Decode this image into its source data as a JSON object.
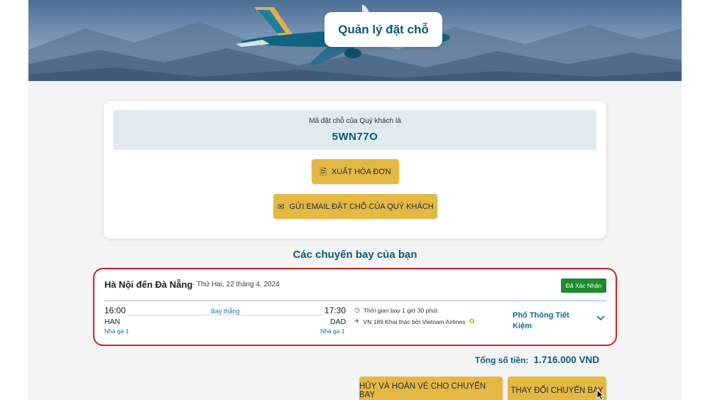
{
  "hero": {
    "title": "Quản lý đặt chỗ"
  },
  "booking": {
    "code_label": "Mã đặt chỗ của Quý khách là",
    "code": "5WN77O",
    "invoice_button": {
      "icon": "document-icon",
      "label": "XUẤT HÓA ĐƠN"
    },
    "email_button": {
      "icon": "mail-icon",
      "label": "GỬI EMAIL ĐẶT CHỖ CỦA QUÝ KHÁCH"
    }
  },
  "flights": {
    "heading": "Các chuyến bay của bạn",
    "items": [
      {
        "route": "Hà Nội đến Đà Nẵng",
        "date": "- Thứ Hai, 22 tháng 4, 2024",
        "status": "Đã Xác Nhận",
        "depart_time": "16:00",
        "depart_code": "HAN",
        "depart_terminal": "Nhà ga 1",
        "arrive_time": "17:30",
        "arrive_code": "DAD",
        "arrive_terminal": "Nhà ga 1",
        "stops": "Bay thẳng",
        "duration": "Thời gian bay 1 giờ 30 phút",
        "flight_info": "VN 189 Khai thác bởi Vietnam Airlines",
        "fare_class": "Phổ Thông Tiết Kiệm"
      }
    ]
  },
  "summary": {
    "total_label": "Tổng số tiền:",
    "total_value": "1.716.000 VND"
  },
  "actions": {
    "cancel_refund": "HỦY VÀ HOÀN VÉ CHO CHUYẾN BAY",
    "change_flight": "THAY ĐỔI CHUYẾN BAY"
  },
  "colors": {
    "brand": "#0b5a78",
    "gold": "#e4b843",
    "confirmed": "#1f8a2e",
    "highlight": "#c8232c"
  }
}
